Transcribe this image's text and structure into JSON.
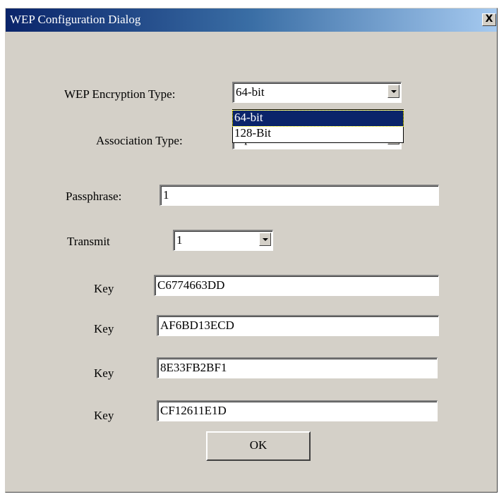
{
  "window": {
    "title": "WEP Configuration Dialog",
    "close_label": "X"
  },
  "form": {
    "encryption_type": {
      "label": "WEP Encryption Type:",
      "value": "64-bit",
      "options": [
        "64-bit",
        "128-Bit"
      ]
    },
    "association_type": {
      "label": "Association Type:",
      "value": "Open"
    },
    "passphrase": {
      "label": "Passphrase:",
      "value": "1"
    },
    "transmit": {
      "label": "Transmit",
      "value": "1"
    },
    "keys": [
      {
        "label": "Key",
        "value": "C6774663DD"
      },
      {
        "label": "Key",
        "value": "AF6BD13ECD"
      },
      {
        "label": "Key",
        "value": "8E33FB2BF1"
      },
      {
        "label": "Key",
        "value": "CF12611E1D"
      }
    ],
    "ok_label": "OK"
  },
  "colors": {
    "dialog_face": "#d4d0c8",
    "title_start": "#0a246a",
    "title_end": "#a6caf0",
    "selection": "#0a246a"
  }
}
